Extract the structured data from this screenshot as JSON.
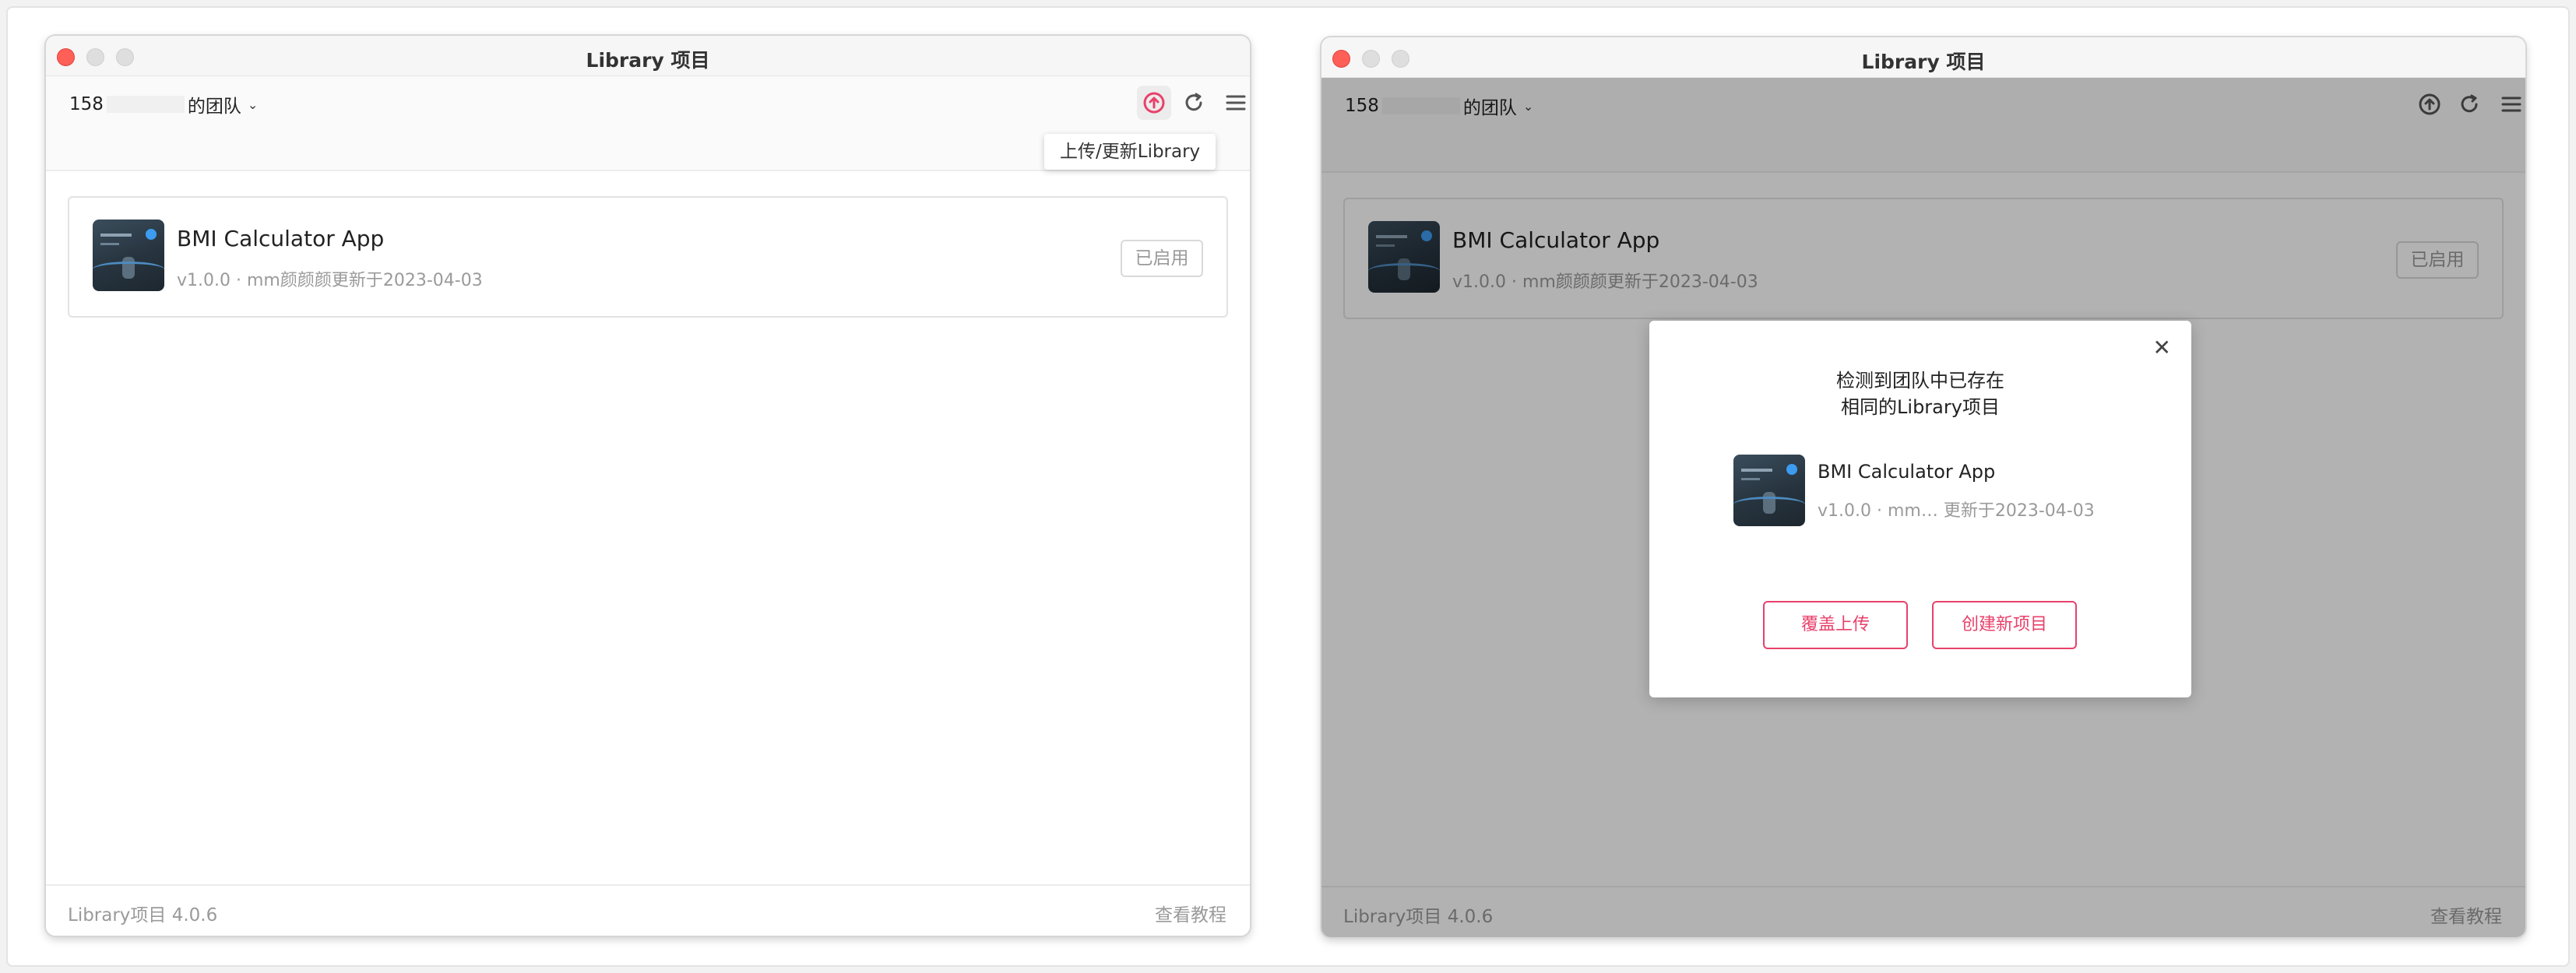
{
  "window_left": {
    "title": "Library 项目",
    "team_prefix": "158",
    "team_suffix": "的团队",
    "tooltip": "上传/更新Library",
    "item": {
      "name": "BMI Calculator App",
      "meta": "v1.0.0 · mm颜颜颜更新于2023-04-03",
      "status_button": "已启用"
    },
    "footer": {
      "version": "Library项目 4.0.6",
      "help_link": "查看教程"
    }
  },
  "window_right": {
    "title": "Library 项目",
    "team_prefix": "158",
    "team_suffix": "的团队",
    "item": {
      "name": "BMI Calculator App",
      "meta": "v1.0.0 · mm颜颜颜更新于2023-04-03",
      "status_button": "已启用"
    },
    "footer": {
      "version": "Library项目 4.0.6",
      "help_link": "查看教程"
    },
    "dialog": {
      "message_line1": "检测到团队中已存在",
      "message_line2": "相同的Library项目",
      "item_name": "BMI Calculator App",
      "item_meta": "v1.0.0 · mm…  更新于2023-04-03",
      "overwrite_button": "覆盖上传",
      "create_button": "创建新项目"
    }
  },
  "icons": {
    "upload": "upload-circle-icon",
    "refresh": "refresh-icon",
    "menu": "menu-icon",
    "close": "close-icon",
    "team_dropdown": "chevron-down-icon"
  },
  "colors": {
    "accent": "#e8416b",
    "close_traffic_light": "#fe5f57"
  }
}
